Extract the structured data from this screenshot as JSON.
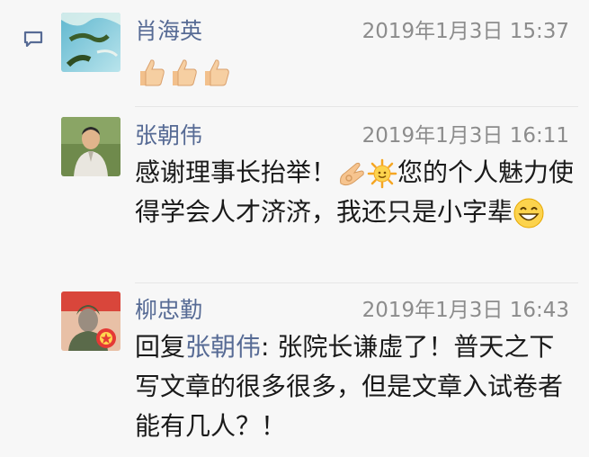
{
  "comments": [
    {
      "name": "肖海英",
      "time": "2019年1月3日 15:37",
      "emojis": [
        "thumbs-up-icon",
        "thumbs-up-icon",
        "thumbs-up-icon"
      ]
    },
    {
      "name": "张朝伟",
      "time": "2019年1月3日 16:11",
      "text_a": "感谢理事长抬举！",
      "text_b": "您的个人魅力使得学会人才济济，我还只是小字辈",
      "emojis": [
        "ok-hand-icon",
        "sun-icon",
        "smile-icon"
      ]
    },
    {
      "name": "柳忠勤",
      "time": "2019年1月3日 16:43",
      "reply_prefix": "回复",
      "reply_to": "张朝伟",
      "text": ": 张院长谦虚了！普天之下写文章的很多很多，但是文章入试卷者能有几人？！"
    }
  ],
  "colors": {
    "name": "#576b95",
    "time": "#8c8c8c",
    "text": "#1a1a1a",
    "background": "#f7f7f7"
  },
  "icons": {
    "comment_indicator": "comment-icon"
  }
}
